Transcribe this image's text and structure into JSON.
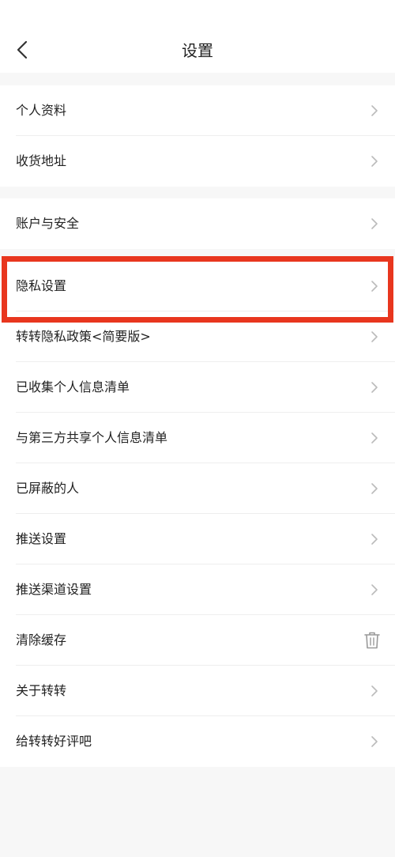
{
  "header": {
    "title": "设置"
  },
  "groups": [
    {
      "items": [
        {
          "label": "个人资料",
          "icon": "chevron-right-icon"
        },
        {
          "label": "收货地址",
          "icon": "chevron-right-icon"
        }
      ]
    },
    {
      "items": [
        {
          "label": "账户与安全",
          "icon": "chevron-right-icon"
        }
      ]
    },
    {
      "items": [
        {
          "label": "隐私设置",
          "icon": "chevron-right-icon"
        },
        {
          "label": "转转隐私政策<简要版>",
          "icon": "chevron-right-icon"
        },
        {
          "label": "已收集个人信息清单",
          "icon": "chevron-right-icon"
        },
        {
          "label": "与第三方共享个人信息清单",
          "icon": "chevron-right-icon"
        },
        {
          "label": "已屏蔽的人",
          "icon": "chevron-right-icon"
        },
        {
          "label": "推送设置",
          "icon": "chevron-right-icon"
        },
        {
          "label": "推送渠道设置",
          "icon": "chevron-right-icon"
        },
        {
          "label": "清除缓存",
          "icon": "trash-icon"
        },
        {
          "label": "关于转转",
          "icon": "chevron-right-icon"
        },
        {
          "label": "给转转好评吧",
          "icon": "chevron-right-icon"
        }
      ]
    }
  ],
  "colors": {
    "highlight": "#e8361e",
    "page_background": "#f7f7f7",
    "chevron": "#bbbbbb"
  }
}
